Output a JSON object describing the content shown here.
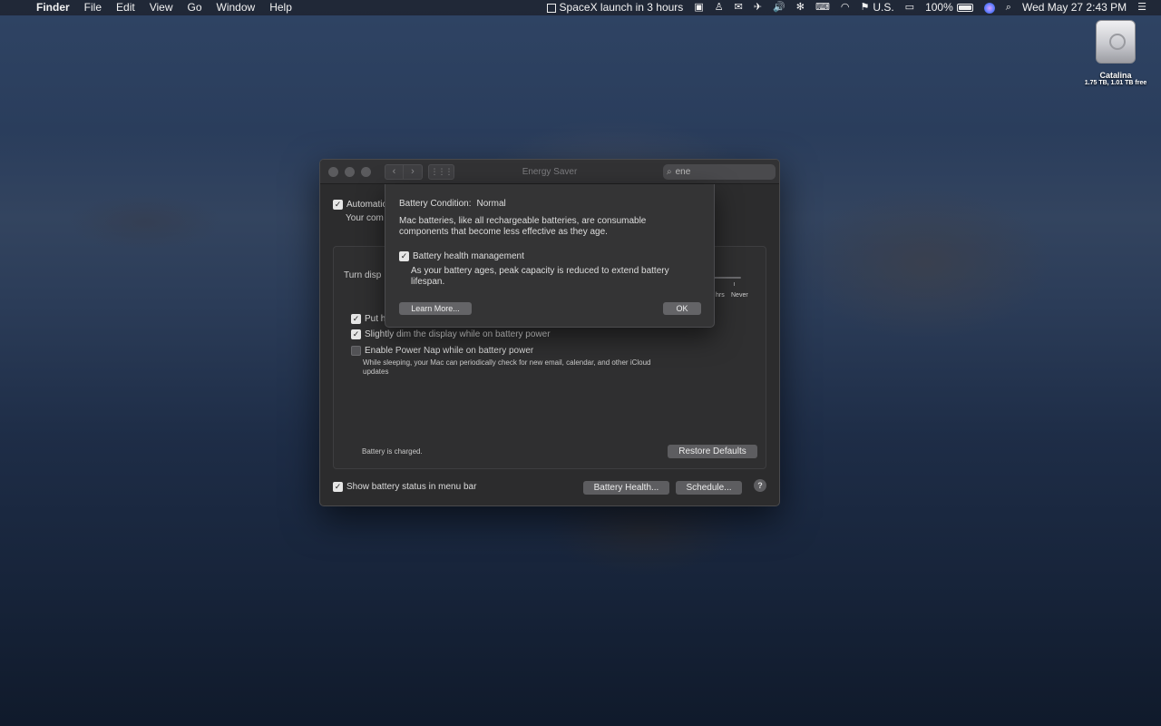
{
  "menubar": {
    "apple": "",
    "app_name": "Finder",
    "menus": [
      "File",
      "Edit",
      "View",
      "Go",
      "Window",
      "Help"
    ],
    "status": {
      "event": "SpaceX launch in 3 hours",
      "input_source": "U.S.",
      "battery_percent": "100%",
      "clock": "Wed May 27  2:43 PM"
    }
  },
  "desktop": {
    "disk_name": "Catalina",
    "disk_info": "1.75 TB, 1.01 TB free"
  },
  "window": {
    "title": "Energy Saver",
    "search_value": "ene",
    "auto_switch_label": "Automatic",
    "auto_switch_sub": "Your com",
    "turn_display_label": "Turn disp",
    "slider_label_hrs": "hrs",
    "slider_label_never": "Never",
    "put_hard_disks_label": "Put h",
    "dim_display_label": "Slightly dim the display while on battery power",
    "power_nap_label": "Enable Power Nap while on battery power",
    "power_nap_desc": "While sleeping, your Mac can periodically check for new email, calendar, and other iCloud updates",
    "battery_status": "Battery is charged.",
    "restore_defaults": "Restore Defaults",
    "show_battery_label": "Show battery status in menu bar",
    "battery_health_button": "Battery Health...",
    "schedule_button": "Schedule...",
    "help": "?"
  },
  "sheet": {
    "condition_label": "Battery Condition:",
    "condition_value": "Normal",
    "description": "Mac batteries, like all rechargeable batteries, are consumable components that become less effective as they age.",
    "management_label": "Battery health management",
    "management_desc": "As your battery ages, peak capacity is reduced to extend battery lifespan.",
    "learn_more": "Learn More...",
    "ok": "OK"
  }
}
